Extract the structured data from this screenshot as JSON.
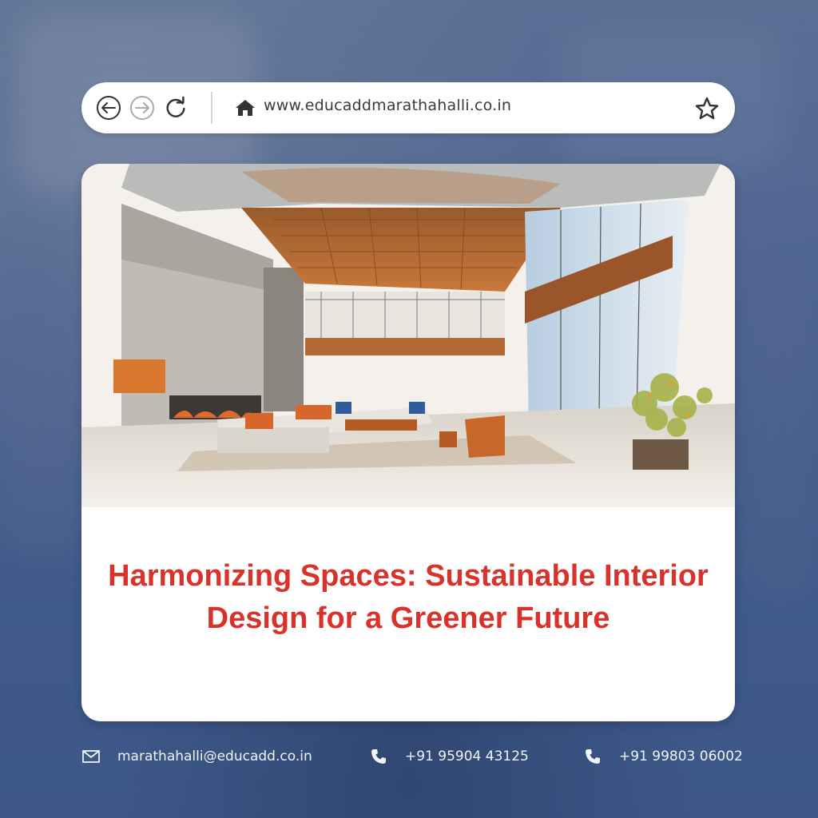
{
  "browser": {
    "url": "www.educaddmarathahalli.co.in",
    "icons": [
      "back-arrow-icon",
      "forward-arrow-icon",
      "reload-icon",
      "home-icon",
      "star-icon"
    ]
  },
  "card": {
    "image_description_icon": "interior-watercolor-illustration",
    "title": "Harmonizing Spaces: Sustainable Interior Design for a Greener Future"
  },
  "footer": {
    "email": "marathahalli@educadd.co.in",
    "phone1": "+91 95904 43125",
    "phone2": "+91 99803 06002"
  },
  "colors": {
    "title": "#d9322b",
    "background": "#4a5f88",
    "card": "#ffffff"
  }
}
